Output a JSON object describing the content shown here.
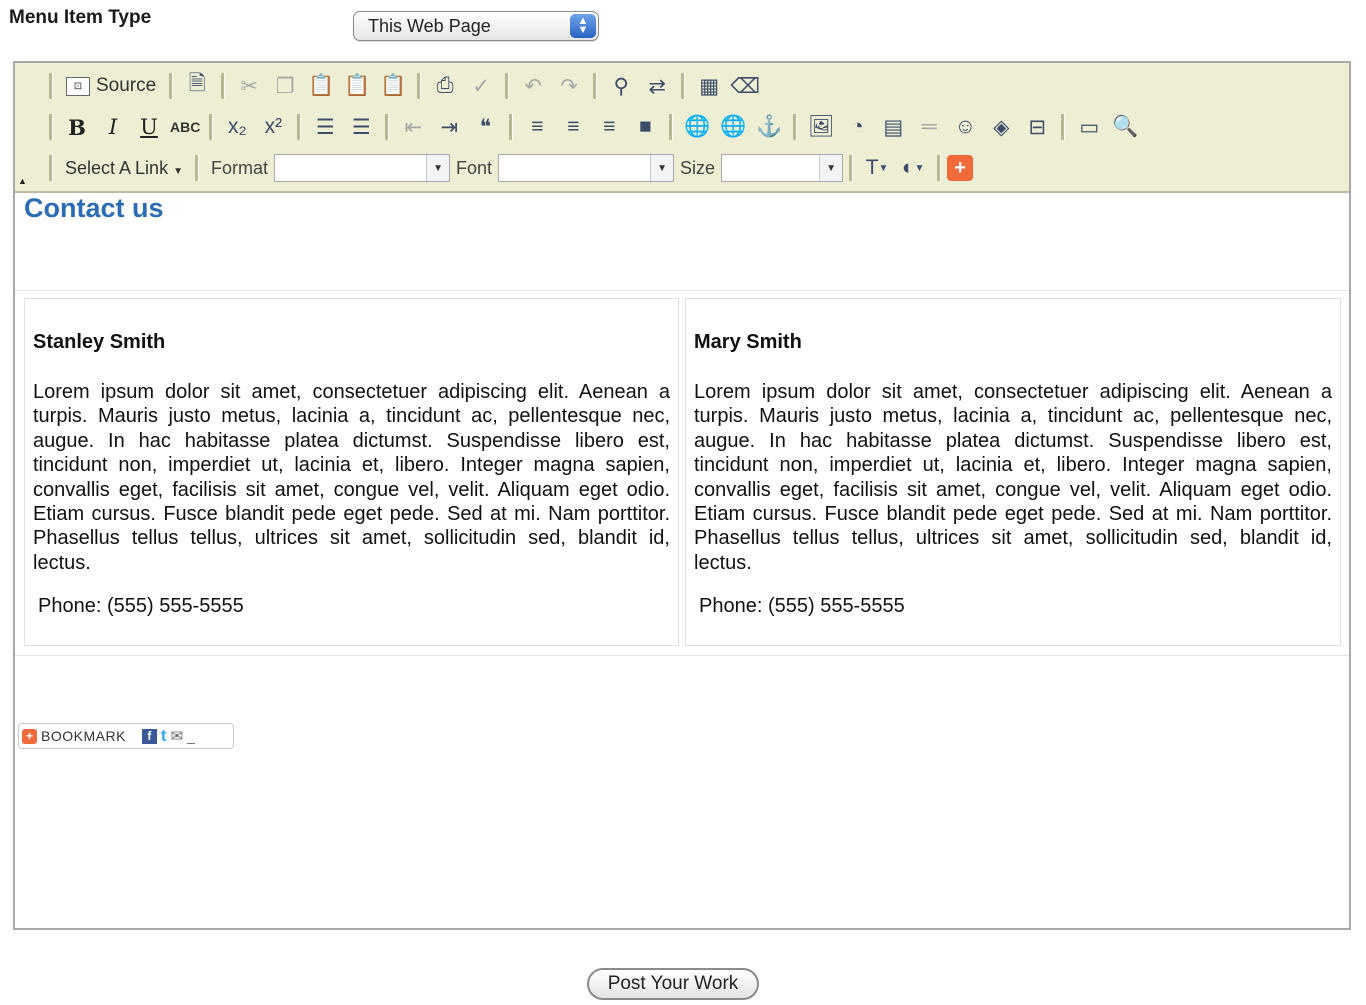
{
  "form": {
    "menu_item_type_label": "Menu Item Type",
    "menu_item_type_value": "This Web Page"
  },
  "toolbar": {
    "source_label": "Source",
    "select_link_label": "Select A Link",
    "format_label": "Format",
    "font_label": "Font",
    "size_label": "Size",
    "format_value": "",
    "font_value": "",
    "size_value": "",
    "bold_glyph": "B",
    "italic_glyph": "I",
    "underline_glyph": "U",
    "strike_glyph": "ABC",
    "quote_glyph": "❝"
  },
  "content": {
    "heading": "Contact us",
    "contacts": [
      {
        "name": "Stanley Smith",
        "body": "Lorem ipsum dolor sit amet, consectetuer adipiscing elit. Aenean a turpis. Mauris justo metus, lacinia a, tincidunt ac, pellentesque nec, augue. In hac habitasse platea dictumst. Suspendisse libero est, tincidunt non, imperdiet ut, lacinia et, libero. Integer magna sapien, convallis eget, facilisis sit amet, congue vel, velit. Aliquam eget odio. Etiam cursus. Fusce blandit pede eget pede. Sed at mi. Nam porttitor. Phasellus tellus tellus, ultrices sit amet, sollicitudin sed, blandit id, lectus.",
        "phone": "Phone: (555) 555-5555"
      },
      {
        "name": "Mary Smith",
        "body": "Lorem ipsum dolor sit amet, consectetuer adipiscing elit. Aenean a turpis. Mauris justo metus, lacinia a, tincidunt ac, pellentesque nec, augue. In hac habitasse platea dictumst. Suspendisse libero est, tincidunt non, imperdiet ut, lacinia et, libero. Integer magna sapien, convallis eget, facilisis sit amet, congue vel, velit. Aliquam eget odio. Etiam cursus. Fusce blandit pede eget pede. Sed at mi. Nam porttitor. Phasellus tellus tellus, ultrices sit amet, sollicitudin sed, blandit id, lectus.",
        "phone": "Phone: (555) 555-5555"
      }
    ],
    "bookmark_label": "BOOKMARK"
  },
  "actions": {
    "post_label": "Post Your Work"
  },
  "icons": {
    "toolbar_row1": [
      "source-icon",
      "new-page-icon",
      "cut-icon",
      "copy-icon",
      "paste-icon",
      "paste-text-icon",
      "paste-word-icon",
      "print-icon",
      "spellcheck-icon",
      "undo-icon",
      "redo-icon",
      "find-icon",
      "replace-icon",
      "select-all-icon",
      "remove-format-icon"
    ],
    "toolbar_row2": [
      "bold-icon",
      "italic-icon",
      "underline-icon",
      "strike-icon",
      "subscript-icon",
      "superscript-icon",
      "ordered-list-icon",
      "unordered-list-icon",
      "outdent-icon",
      "indent-icon",
      "blockquote-icon",
      "align-left-icon",
      "align-center-icon",
      "align-right-icon",
      "justify-icon",
      "link-icon",
      "unlink-icon",
      "anchor-icon",
      "image-icon",
      "flash-icon",
      "table-icon",
      "horizontal-rule-icon",
      "smiley-icon",
      "special-char-icon",
      "page-break-icon",
      "maximize-icon",
      "preview-icon"
    ],
    "toolbar_row3": [
      "text-color-icon",
      "background-color-icon",
      "addthis-plus-icon"
    ]
  },
  "colors": {
    "toolbar_bg": "#eeeed4",
    "heading": "#2b6cb4",
    "accent_orange": "#f06a3c"
  }
}
